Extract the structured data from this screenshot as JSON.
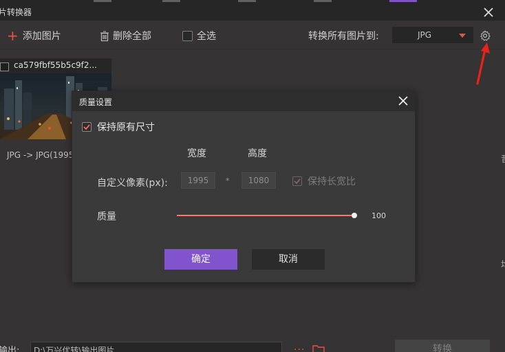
{
  "window": {
    "title": "片转换器",
    "close_icon": "close-icon"
  },
  "toolbar": {
    "add_label": "添加图片",
    "delete_all_label": "删除全部",
    "select_all_label": "全选",
    "convert_all_label": "转换所有图片到:",
    "format_value": "JPG",
    "settings_icon": "gear-icon"
  },
  "image_card": {
    "filename": "ca579fbf55b5c9f2...",
    "caption": "JPG -> JPG(1995"
  },
  "side_fragments": {
    "right_char_1": "音",
    "right_char_2": "均"
  },
  "bottom": {
    "output_label": "输出:",
    "output_path": "D:\\万兴优转\\输出图片",
    "more_label": "...",
    "convert_label": "转换"
  },
  "dialog": {
    "title": "质量设置",
    "keep_original_label": "保持原有尺寸",
    "keep_original_checked": true,
    "width_header": "宽度",
    "height_header": "高度",
    "custom_px_label": "自定义像素(px):",
    "width_value": "1995",
    "height_value": "1080",
    "times_symbol": "*",
    "keep_aspect_label": "保持长宽比",
    "keep_aspect_checked": true,
    "quality_label": "质量",
    "quality_value": "100",
    "quality_fraction": 1.0,
    "ok_label": "确定",
    "cancel_label": "取消"
  },
  "colors": {
    "accent_red": "#ff5a4b",
    "primary_purple": "#8153cc",
    "slider_track": "#ff7a6a",
    "annotation_arrow": "#e8231a"
  }
}
